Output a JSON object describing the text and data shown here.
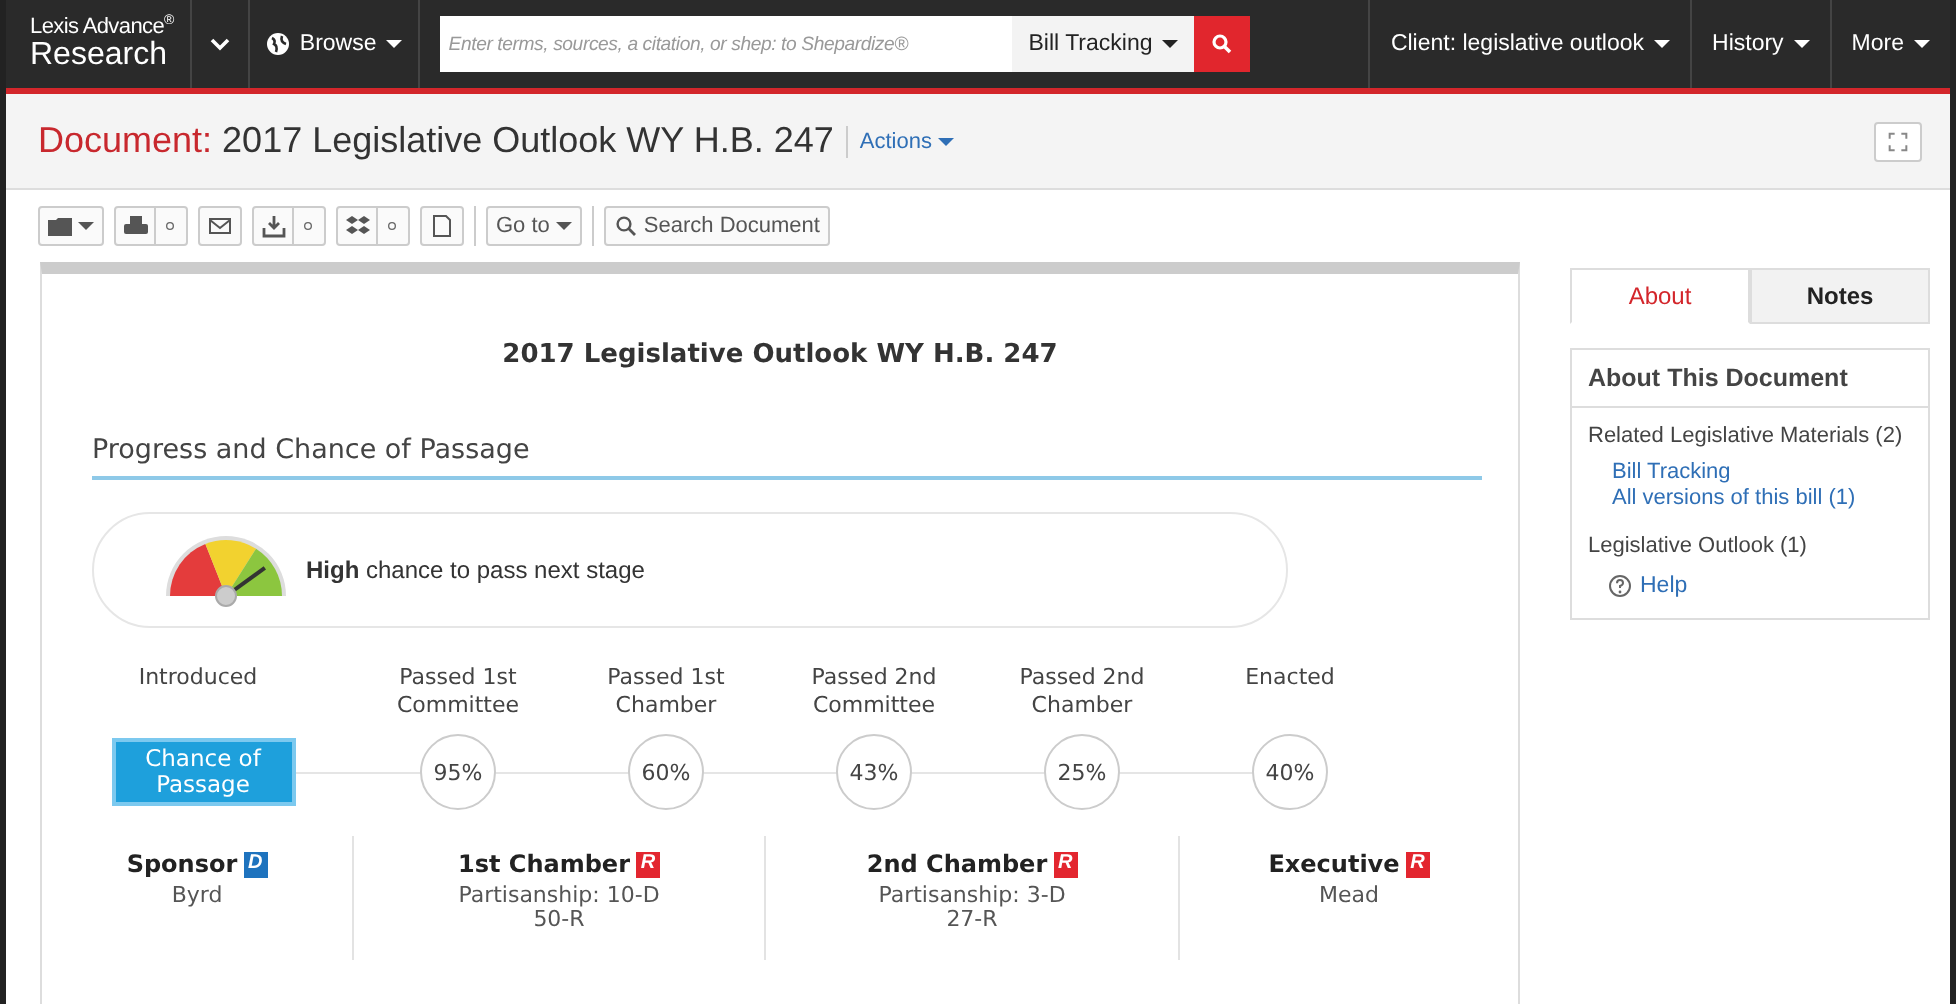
{
  "nav": {
    "brand_top": "Lexis Advance$^{®}$",
    "brand_bottom": "Research",
    "browse": "Browse",
    "search": {
      "placeholder": "Enter terms, sources, a citation, or shep: to Shepardize®"
    },
    "search_scope": "Bill Tracking",
    "menus": [
      "Client: legislative outlook",
      "History",
      "More"
    ]
  },
  "document_header": {
    "label": "Document:",
    "title": "2017 Legislative Outlook WY H.B. 247",
    "actions": "Actions"
  },
  "toolbar": {
    "goto": "Go to",
    "search": "Search Document"
  },
  "document": {
    "heading": "2017 Legislative Outlook WY H.B. 247",
    "section_title": "Progress and Chance of Passage",
    "outlook": {
      "text": "**High** chance to pass next stage"
    },
    "chance_label": "Chance of Passage",
    "stages": [
      {
        "label": "Introduced"
      },
      {
        "label": "Passed 1st Committee",
        "chance": "95%"
      },
      {
        "label": "Passed 1st Chamber",
        "chance": "60%"
      },
      {
        "label": "Passed 2nd Committee",
        "chance": "43%"
      },
      {
        "label": "Passed 2nd Chamber",
        "chance": "25%"
      },
      {
        "label": "Enacted",
        "chance": "40%"
      }
    ],
    "parties": [
      {
        "title": "Sponsor",
        "party": "D",
        "color": "#1e73be",
        "lines": [
          "Byrd"
        ]
      },
      {
        "title": "1st Chamber",
        "party": "R",
        "color": "#e3262f",
        "lines": [
          "Partisanship: 10-D",
          "50-R"
        ]
      },
      {
        "title": "2nd Chamber",
        "party": "R",
        "color": "#e3262f",
        "lines": [
          "Partisanship: 3-D",
          "27-R"
        ]
      },
      {
        "title": "Executive",
        "party": "R",
        "color": "#e3262f",
        "lines": [
          "Mead"
        ]
      }
    ]
  },
  "sidebar": {
    "tabs": [
      {
        "label": "About",
        "selected": true
      },
      {
        "label": "Notes",
        "selected": false
      }
    ],
    "box_title": "About This Document",
    "sections": [
      {
        "title": "Related Legislative Materials (2)",
        "links": [
          "Bill Tracking",
          "All versions of this bill (1)"
        ]
      },
      {
        "title": "Legislative Outlook (1)"
      }
    ],
    "help": "Help"
  }
}
